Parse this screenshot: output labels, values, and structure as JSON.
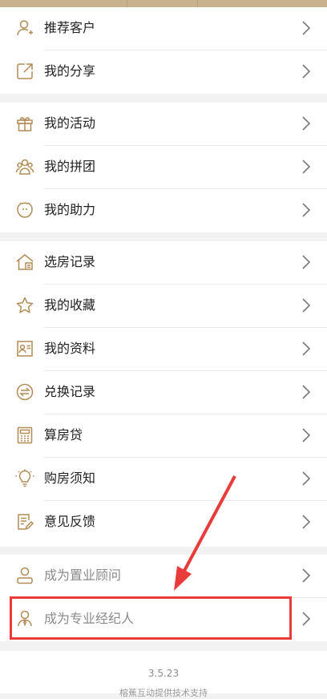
{
  "sections": [
    {
      "items": [
        {
          "name": "recommend-customer",
          "label": "推荐客户",
          "icon": "user-icon"
        },
        {
          "name": "my-share",
          "label": "我的分享",
          "icon": "share-icon"
        }
      ]
    },
    {
      "items": [
        {
          "name": "my-activities",
          "label": "我的活动",
          "icon": "gift-icon"
        },
        {
          "name": "my-group-buy",
          "label": "我的拼团",
          "icon": "group-icon"
        },
        {
          "name": "my-boost",
          "label": "我的助力",
          "icon": "pig-icon"
        }
      ]
    },
    {
      "items": [
        {
          "name": "room-selection-record",
          "label": "选房记录",
          "icon": "house-icon"
        },
        {
          "name": "my-favorites",
          "label": "我的收藏",
          "icon": "star-icon"
        },
        {
          "name": "my-profile",
          "label": "我的资料",
          "icon": "id-card-icon"
        },
        {
          "name": "exchange-record",
          "label": "兑换记录",
          "icon": "exchange-icon"
        },
        {
          "name": "mortgage-calculator",
          "label": "算房贷",
          "icon": "calculator-icon"
        },
        {
          "name": "purchase-guide",
          "label": "购房须知",
          "icon": "lightbulb-icon"
        },
        {
          "name": "feedback",
          "label": "意见反馈",
          "icon": "edit-note-icon"
        }
      ]
    },
    {
      "items": [
        {
          "name": "become-property-consultant",
          "label": "成为置业顾问",
          "icon": "consultant-icon"
        },
        {
          "name": "become-agent",
          "label": "成为专业经纪人",
          "icon": "agent-icon"
        }
      ]
    }
  ],
  "footer": {
    "version": "3.5.23",
    "tech_support": "榕蕉互动提供技术支持"
  },
  "colors": {
    "icon_gold": "#b28b55",
    "highlight_red": "#ea3b3b"
  }
}
